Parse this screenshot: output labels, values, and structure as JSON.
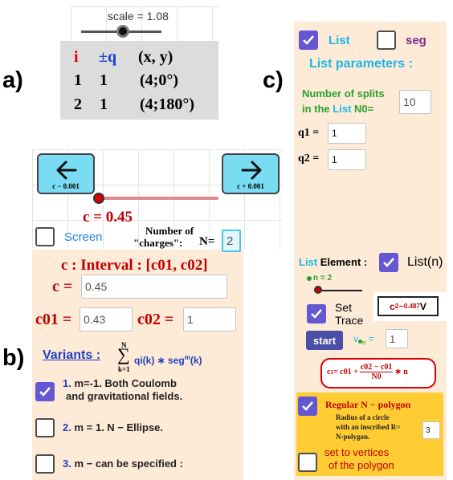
{
  "labels": {
    "a": "a)",
    "b": "b)",
    "c": "c)"
  },
  "panel_a": {
    "scale_text": "scale = 1.08",
    "table_headers": [
      "i",
      "±q",
      "(x, y)"
    ],
    "rows": [
      {
        "i": "1",
        "q": "1",
        "xy": "(4;0°)"
      },
      {
        "i": "2",
        "q": "1",
        "xy": "(4;180°)"
      }
    ]
  },
  "panel_b": {
    "left_button_caption": "c − 0.001",
    "right_button_caption": "c + 0.001",
    "c_display": "c = 0.45",
    "screen_label": "Screen",
    "charges_label_line1": "Number of",
    "charges_label_line2": "\"charges\":",
    "n_label": "N=",
    "n_value": "2",
    "interval_title": "c :  Interval : [c01, c02]",
    "c_label": "c =",
    "c_value": "0.45",
    "c01_label": "c01 =",
    "c01_value": "0.43",
    "c02_label": "c02 =",
    "c02_value": "1",
    "variants_label": "Variants :",
    "sum_top": "N",
    "sum_bottom": "k=1",
    "sum_expr": "qi(k) ∗ seg",
    "sum_sup": "m",
    "sum_tail": "(k)",
    "options": [
      {
        "num": "1.",
        "text": "m=-1. Both Coulomb",
        "text2": "and gravitational fields.",
        "checked": true
      },
      {
        "num": "2.",
        "text": "m = 1. N − Ellipse.",
        "checked": false
      },
      {
        "num": "3.",
        "text": "m − can be specified :",
        "checked": false
      }
    ]
  },
  "panel_c": {
    "list_label": "List",
    "list_checked": true,
    "seg_label": "seg",
    "seg_checked": false,
    "list_params_title": "List parameters :",
    "splits_line1": "Number of splits",
    "splits_line2_a": "in the ",
    "splits_line2_b": "List",
    "splits_line2_c": " N0=",
    "n0_value": "10",
    "q1_label": "q1 =",
    "q1_value": "1",
    "q2_label": "q2 =",
    "q2_value": "1",
    "list_element_a": "List",
    "list_element_b": " Element :",
    "list_n_label": "List(n)",
    "list_n_checked": true,
    "n_slider_text": "n = 2",
    "set_trace_line1": "Set",
    "set_trace_line2": "Trace",
    "set_trace_checked": true,
    "c2_text": "c",
    "c2_sub": "2∼0.487",
    "c2_unit": "V",
    "start_label": "start",
    "v_label": "v",
    "v_sub": "n",
    "v_eq": " =",
    "v_value": "1",
    "formula_lhs": "c",
    "formula_lhs_sub": "1",
    "formula_mid": " = c01 + ",
    "formula_num": "c02 − c01",
    "formula_den": "N0",
    "formula_tail": " ∗ n",
    "polygon_label": "Regular N − polygon",
    "polygon_checked": true,
    "radius_line1": "Radius of a circle",
    "radius_line2": "with an inscribed R=",
    "radius_line3": "N-polygon.",
    "r_value": "3",
    "vertices_line1": "set to vertices",
    "vertices_line2": "of the polygon",
    "vertices_checked": false
  },
  "colors": {
    "panel_bg": "#fdebd7",
    "accent_purple": "#6557d2",
    "button_cyan": "#79dcf2",
    "red": "#c00000",
    "blue": "#1f4fbf",
    "green": "#2aa12a",
    "cyan_text": "#1fb6e6",
    "yellow": "#ffcc33"
  }
}
